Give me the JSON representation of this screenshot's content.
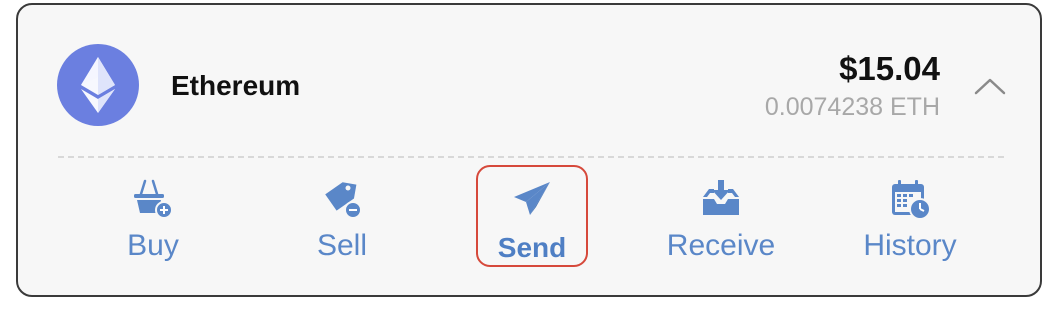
{
  "token": {
    "name": "Ethereum",
    "logo_icon": "ethereum-logo",
    "logo_color": "#6b7fe0"
  },
  "balance": {
    "usd": "$15.04",
    "eth": "0.0074238 ETH"
  },
  "toggle_icon": "chevron-up-icon",
  "actions": [
    {
      "label": "Buy",
      "icon": "basket-plus-icon"
    },
    {
      "label": "Sell",
      "icon": "tag-minus-icon"
    },
    {
      "label": "Send",
      "icon": "paper-plane-icon",
      "selected": true
    },
    {
      "label": "Receive",
      "icon": "inbox-download-icon"
    },
    {
      "label": "History",
      "icon": "calendar-clock-icon"
    }
  ],
  "colors": {
    "accent": "#5a87c8",
    "highlight": "#d6493b",
    "muted_text": "#a8a8a8"
  }
}
